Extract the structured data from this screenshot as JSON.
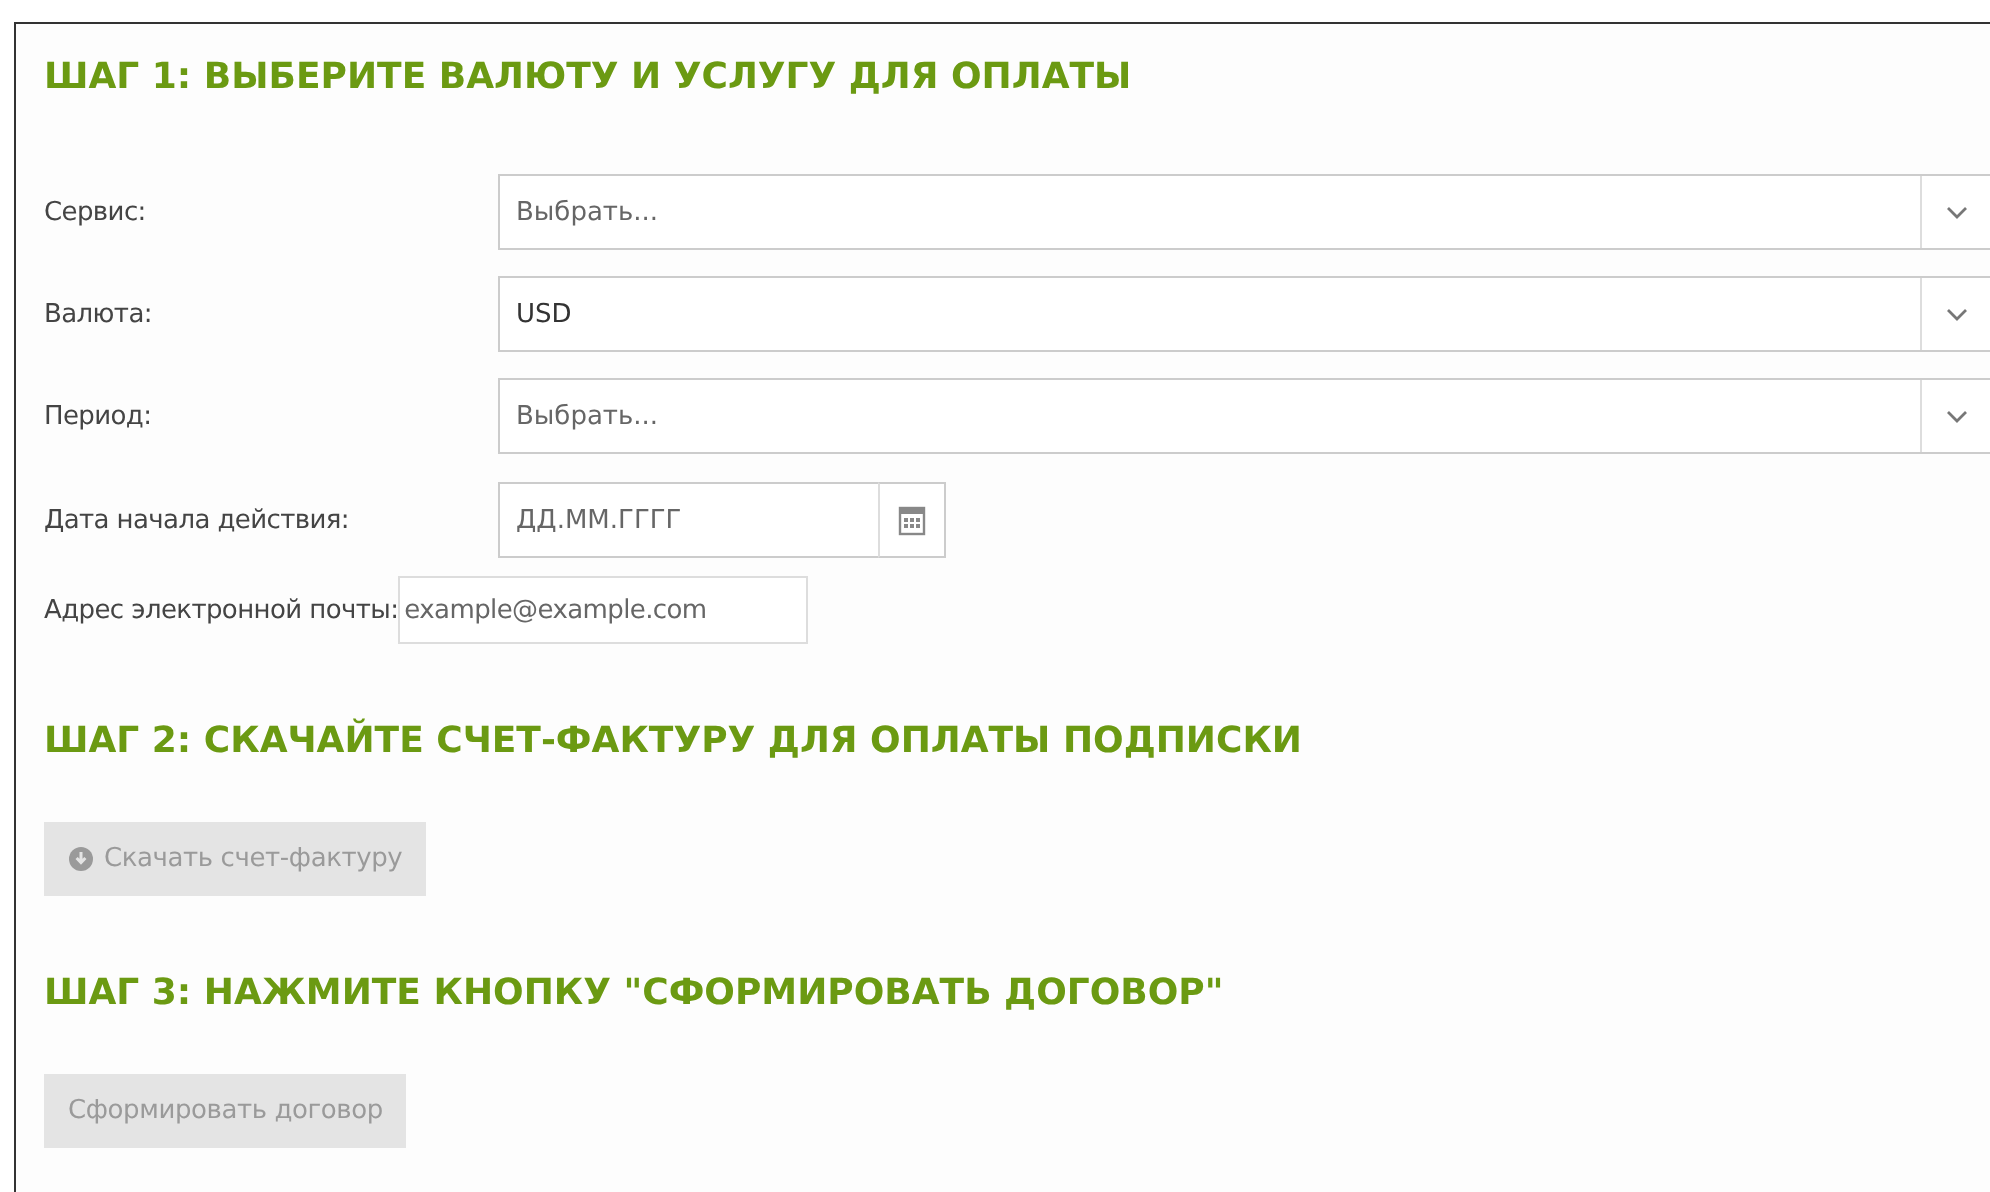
{
  "step1": {
    "title": "ШАГ 1: ВЫБЕРИТЕ ВАЛЮТУ И УСЛУГУ ДЛЯ ОПЛАТЫ",
    "fields": [
      {
        "kind": "select",
        "label": "Сервис:",
        "placeholder": "Выбрать..."
      },
      {
        "kind": "select",
        "label": "Валюта:",
        "value": "USD"
      },
      {
        "kind": "select",
        "label": "Период:",
        "placeholder": "Выбрать..."
      },
      {
        "kind": "date",
        "label": "Дата начала действия:",
        "placeholder": "ДД.ММ.ГГГГ"
      },
      {
        "kind": "email",
        "label": "Адрес электронной почты:",
        "placeholder": "example@example.com"
      }
    ]
  },
  "step2": {
    "title": "ШАГ 2: СКАЧАЙТЕ СЧЕТ-ФАКТУРУ ДЛЯ ОПЛАТЫ ПОДПИСКИ",
    "button": {
      "label": "Скачать счет-фактуру",
      "disabled": true
    }
  },
  "step3": {
    "title": "ШАГ 3: НАЖМИТЕ КНОПКУ \"СФОРМИРОВАТЬ ДОГОВОР\"",
    "button": {
      "label": "Сформировать договор",
      "disabled": true
    }
  }
}
